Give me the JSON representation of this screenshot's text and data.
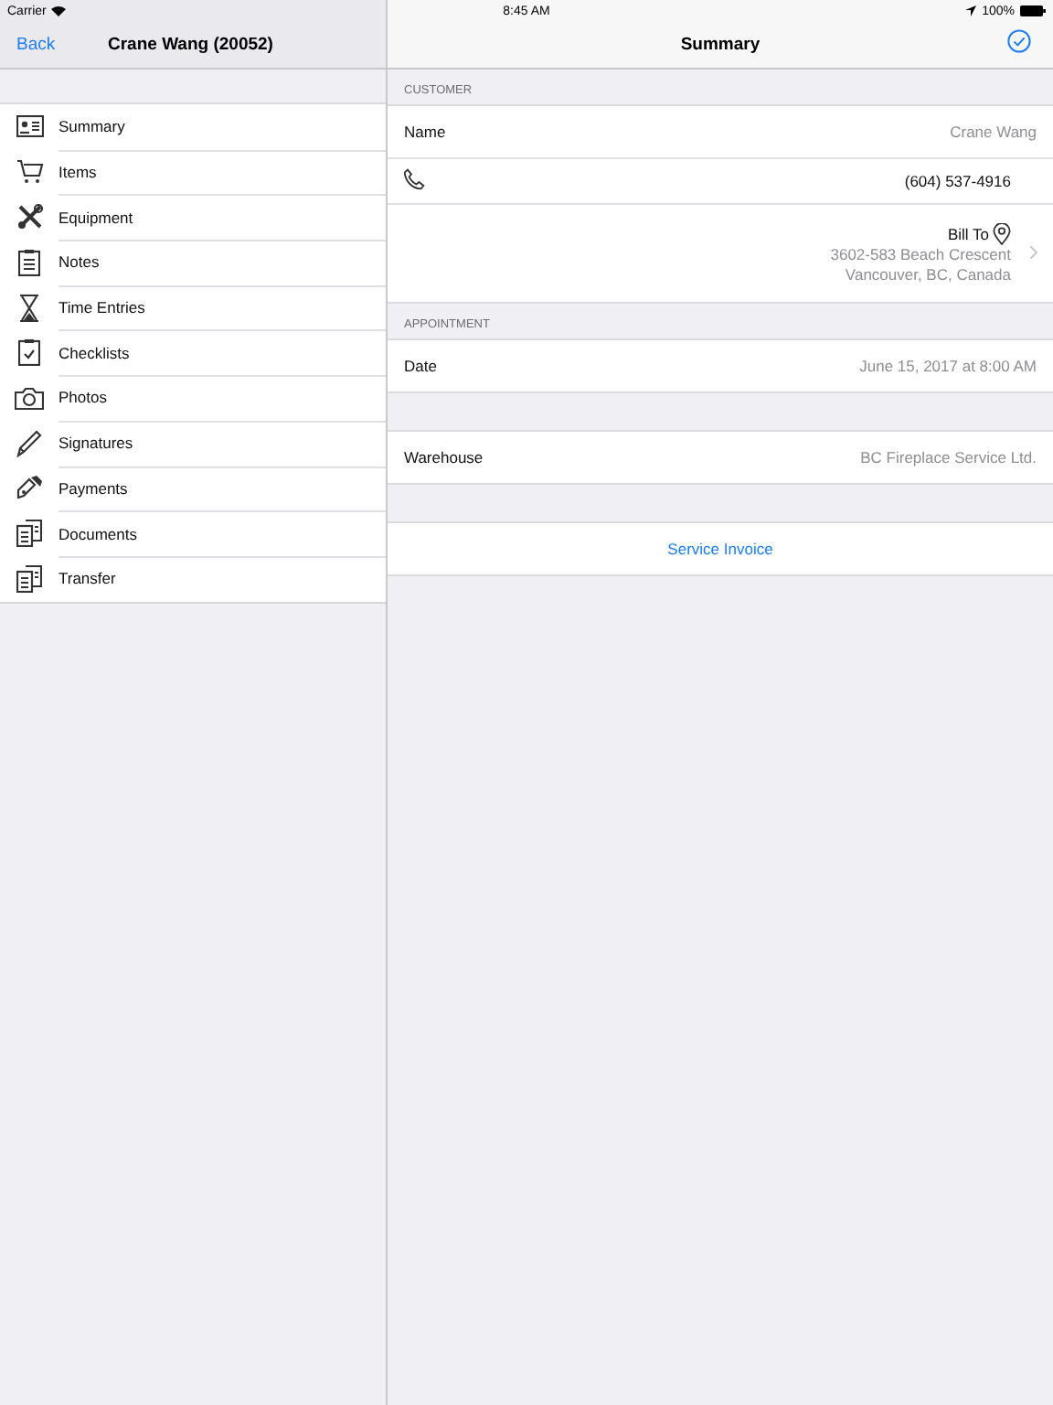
{
  "status_bar": {
    "carrier": "Carrier",
    "time": "8:45 AM",
    "battery": "100%"
  },
  "sidebar": {
    "back": "Back",
    "title": "Crane Wang (20052)",
    "items": [
      {
        "label": "Summary",
        "kind": "card"
      },
      {
        "label": "Items",
        "kind": "cart"
      },
      {
        "label": "Equipment",
        "kind": "tools"
      },
      {
        "label": "Notes",
        "kind": "clipboard"
      },
      {
        "label": "Time Entries",
        "kind": "hourglass"
      },
      {
        "label": "Checklists",
        "kind": "checklist"
      },
      {
        "label": "Photos",
        "kind": "camera"
      },
      {
        "label": "Signatures",
        "kind": "pen"
      },
      {
        "label": "Payments",
        "kind": "payment"
      },
      {
        "label": "Documents",
        "kind": "documents"
      },
      {
        "label": "Transfer",
        "kind": "documents"
      }
    ]
  },
  "detail": {
    "title": "Summary",
    "sections": [
      {
        "header": "CUSTOMER",
        "rows": [
          {
            "kind": "field",
            "label": "Name",
            "value": "Crane Wang"
          },
          {
            "kind": "phone",
            "value": "(604) 537-4916"
          },
          {
            "kind": "address",
            "label": "Bill To",
            "lines": [
              "3602-583 Beach Crescent",
              "Vancouver, BC, Canada"
            ]
          }
        ]
      },
      {
        "header": "APPOINTMENT",
        "rows": [
          {
            "kind": "field",
            "label": "Date",
            "value": "June 15, 2017 at 8:00 AM"
          }
        ]
      },
      {
        "rows": [
          {
            "kind": "field",
            "label": "Warehouse",
            "value": "BC Fireplace Service Ltd."
          }
        ]
      },
      {
        "rows": [
          {
            "kind": "action",
            "label": "Service Invoice"
          }
        ]
      }
    ]
  }
}
